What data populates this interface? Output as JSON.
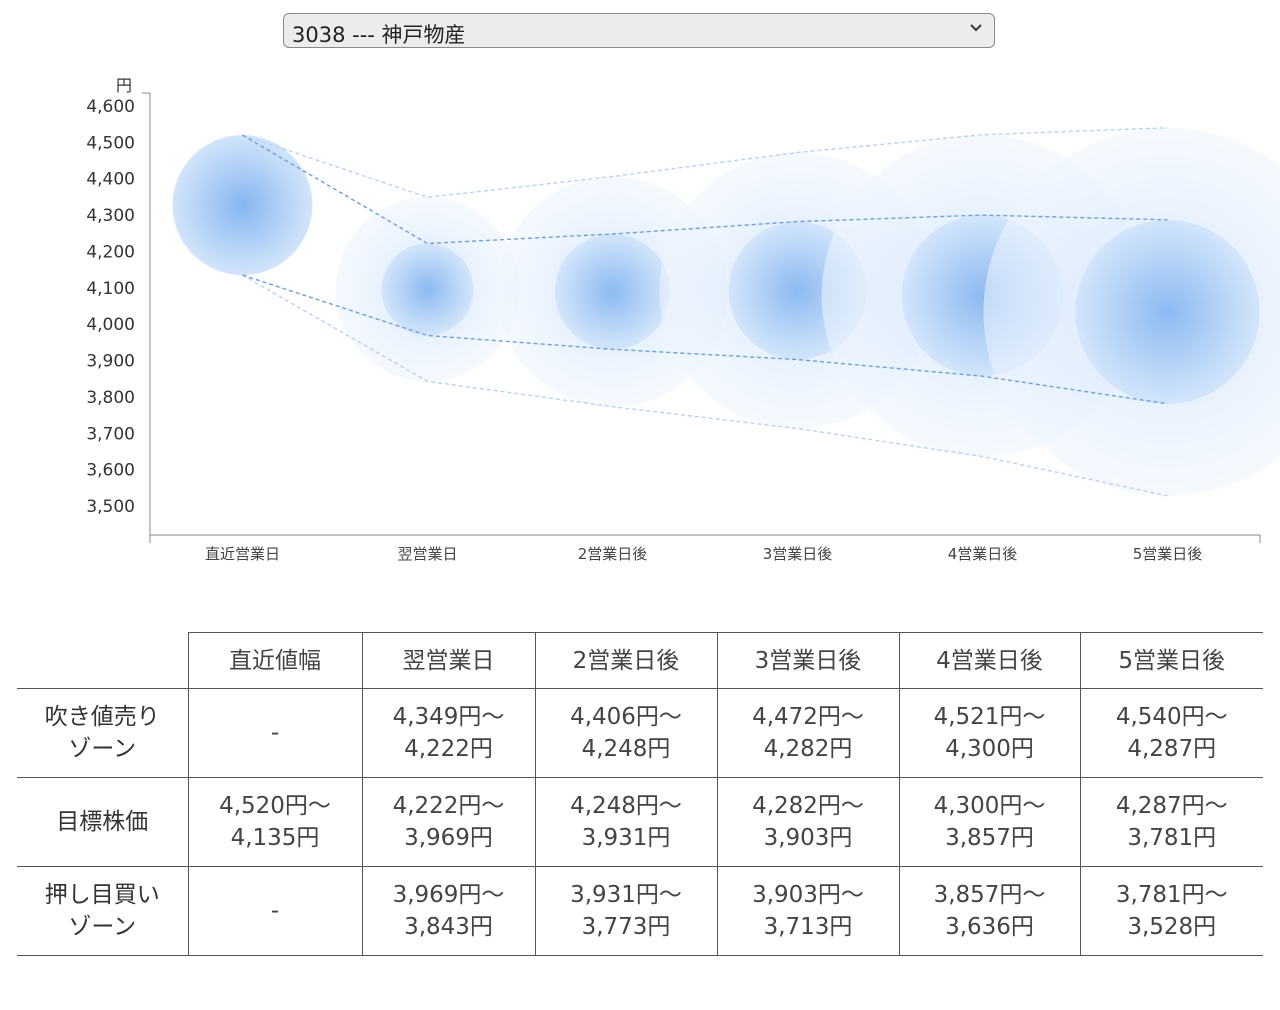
{
  "selector": {
    "value": "3038 --- 神戸物産",
    "arrow_icon": "chevron-down-icon"
  },
  "chart_data": {
    "type": "bubble-range",
    "ylabel": "円",
    "ylim": [
      3500,
      4600
    ],
    "yticks": [
      3500,
      3600,
      3700,
      3800,
      3900,
      4000,
      4100,
      4200,
      4300,
      4400,
      4500,
      4600
    ],
    "ytick_labels": [
      "3,500",
      "3,600",
      "3,700",
      "3,800",
      "3,900",
      "4,000",
      "4,100",
      "4,200",
      "4,300",
      "4,400",
      "4,500",
      "4,600"
    ],
    "categories": [
      "直近営業日",
      "翌営業日",
      "2営業日後",
      "3営業日後",
      "4営業日後",
      "5営業日後"
    ],
    "series": [
      {
        "high": [
          4520,
          4349,
          4406,
          4472,
          4521,
          4540
        ]
      },
      {
        "high": [
          4520,
          4222,
          4248,
          4282,
          4300,
          4287
        ]
      },
      {
        "low": [
          4135,
          3969,
          3931,
          3903,
          3857,
          3781
        ]
      },
      {
        "low": [
          4135,
          3843,
          3773,
          3713,
          3636,
          3528
        ]
      }
    ],
    "colors": {
      "bubble_center": "#7fb2ee",
      "bubble_mid": "#cfe3fb",
      "bubble_edge": "#eef5fe",
      "line": "#6a9fe0"
    }
  },
  "table": {
    "headers": [
      "",
      "直近値幅",
      "翌営業日",
      "2営業日後",
      "3営業日後",
      "4営業日後",
      "5営業日後"
    ],
    "rows": [
      {
        "label": [
          "吹き値売り",
          "ゾーン"
        ],
        "cells": [
          [
            "-"
          ],
          [
            "4,349円〜",
            "4,222円"
          ],
          [
            "4,406円〜",
            "4,248円"
          ],
          [
            "4,472円〜",
            "4,282円"
          ],
          [
            "4,521円〜",
            "4,300円"
          ],
          [
            "4,540円〜",
            "4,287円"
          ]
        ]
      },
      {
        "label": [
          "目標株価"
        ],
        "cells": [
          [
            "4,520円〜",
            "4,135円"
          ],
          [
            "4,222円〜",
            "3,969円"
          ],
          [
            "4,248円〜",
            "3,931円"
          ],
          [
            "4,282円〜",
            "3,903円"
          ],
          [
            "4,300円〜",
            "3,857円"
          ],
          [
            "4,287円〜",
            "3,781円"
          ]
        ]
      },
      {
        "label": [
          "押し目買い",
          "ゾーン"
        ],
        "cells": [
          [
            "-"
          ],
          [
            "3,969円〜",
            "3,843円"
          ],
          [
            "3,931円〜",
            "3,773円"
          ],
          [
            "3,903円〜",
            "3,713円"
          ],
          [
            "3,857円〜",
            "3,636円"
          ],
          [
            "3,781円〜",
            "3,528円"
          ]
        ]
      }
    ]
  }
}
